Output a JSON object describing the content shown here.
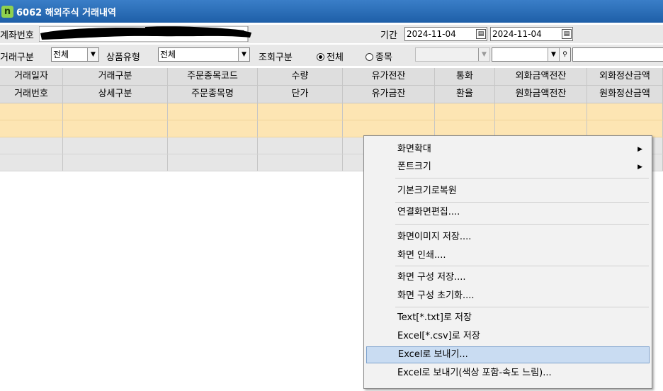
{
  "window": {
    "logo_text": "n",
    "title": "6062 해외주식 거래내역"
  },
  "filters": {
    "account_label": "계좌번호",
    "period_label": "기간",
    "start_date": "2024-11-04",
    "end_date": "2024-11-04",
    "trade_type_label": "거래구분",
    "trade_type_value": "전체",
    "product_type_label": "상품유형",
    "product_type_value": "전체",
    "query_type_label": "조회구분",
    "radio_all": "전체",
    "radio_item": "종목",
    "selected_radio": "전체"
  },
  "grid": {
    "header_row1": [
      "거래일자",
      "거래구분",
      "주문종목코드",
      "수량",
      "유가전잔",
      "통화",
      "외화금액전잔",
      "외화정산금액"
    ],
    "header_row2": [
      "거래번호",
      "상세구분",
      "주문종목명",
      "단가",
      "유가금잔",
      "환율",
      "원화금액전잔",
      "원화정산금액"
    ]
  },
  "context_menu": {
    "items": [
      {
        "label": "화면확대",
        "submenu": true
      },
      {
        "label": "폰트크기",
        "submenu": true
      },
      {
        "label": "기본크기로복원"
      },
      {
        "label": "연결화면편집...."
      },
      {
        "label": "화면이미지 저장...."
      },
      {
        "label": "화면 인쇄...."
      },
      {
        "label": "화면 구성 저장...."
      },
      {
        "label": "화면 구성 초기화...."
      },
      {
        "label": "Text[*.txt]로 저장"
      },
      {
        "label": "Excel[*.csv]로 저장"
      },
      {
        "label": "Excel로 보내기..."
      },
      {
        "label": "Excel로 보내기(색상 포함-속도 느림)..."
      }
    ],
    "highlighted_item": "Excel로 보내기..."
  },
  "colors": {
    "title_bar": "#1e5fa8",
    "row_highlight": "#fde5b3",
    "menu_highlight": "#c9dcf2"
  }
}
